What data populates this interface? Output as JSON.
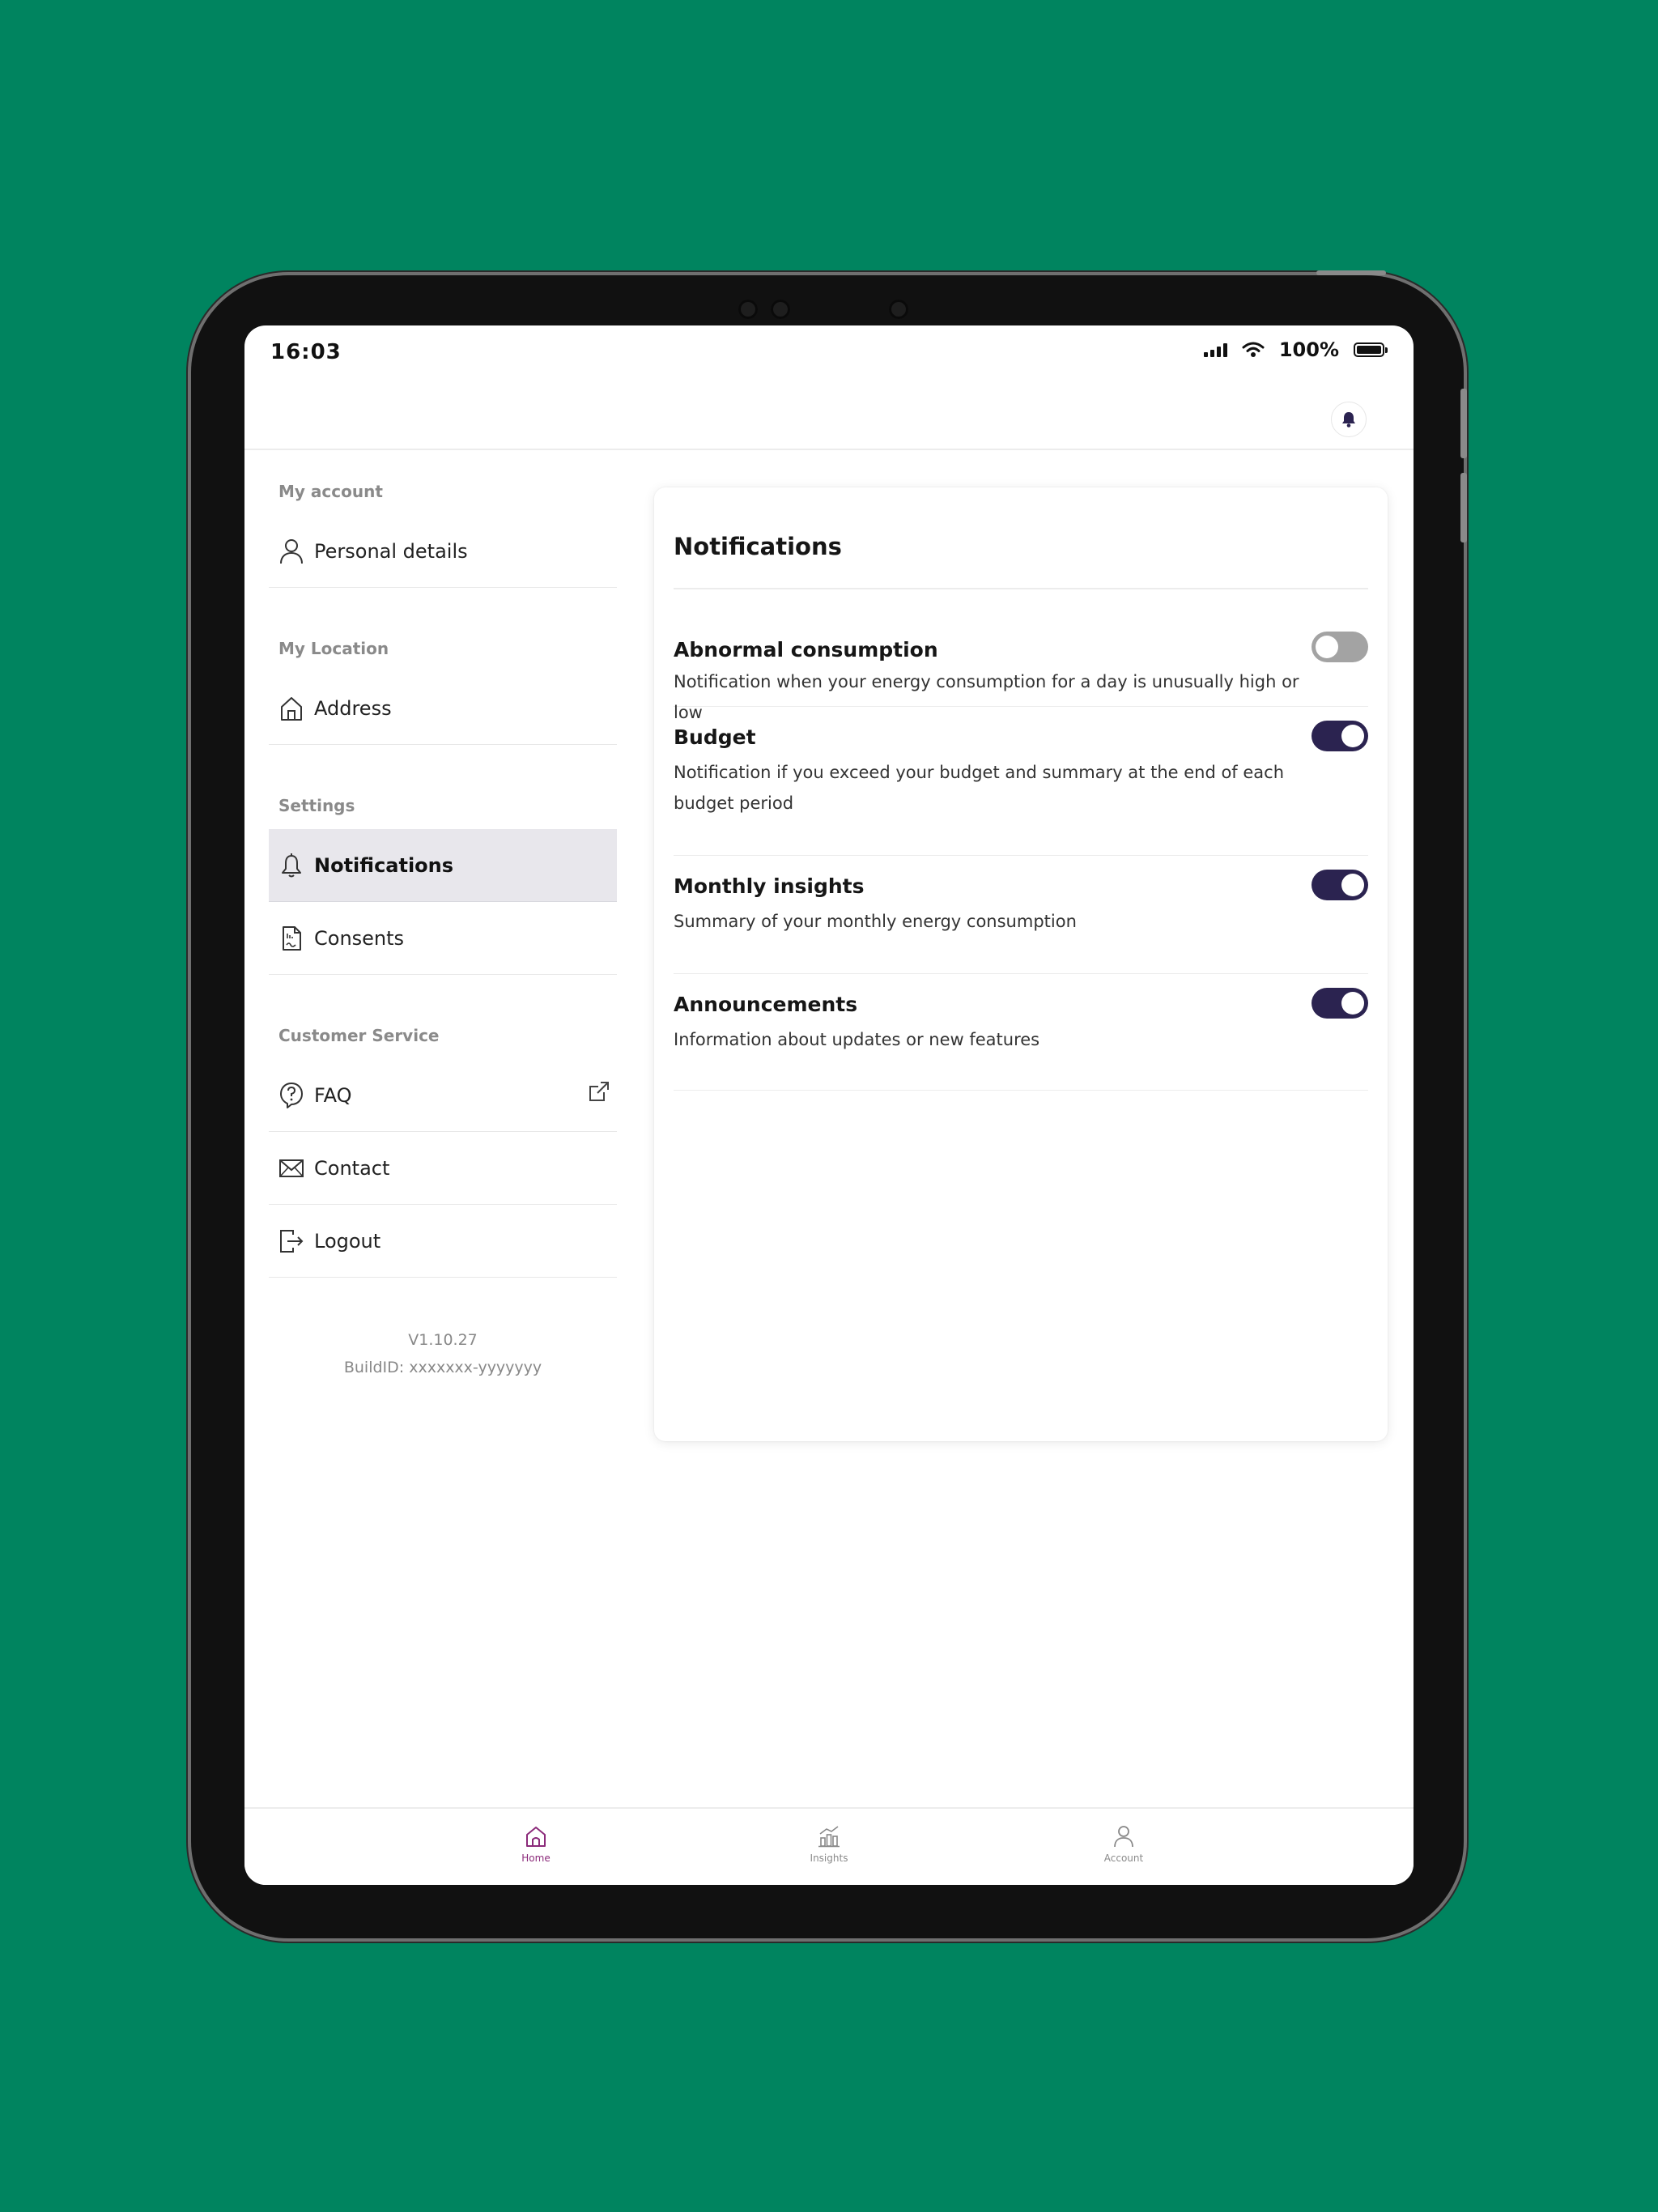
{
  "status_bar": {
    "time": "16:03",
    "battery": "100%"
  },
  "sidebar": {
    "sections": [
      {
        "label": "My account",
        "items": [
          {
            "label": "Personal details"
          }
        ]
      },
      {
        "label": "My Location",
        "items": [
          {
            "label": "Address"
          }
        ]
      },
      {
        "label": "Settings",
        "items": [
          {
            "label": "Notifications"
          },
          {
            "label": "Consents"
          }
        ]
      },
      {
        "label": "Customer Service",
        "items": [
          {
            "label": "FAQ"
          },
          {
            "label": "Contact"
          },
          {
            "label": "Logout"
          }
        ]
      }
    ],
    "version": "V1.10.27",
    "build_id": "BuildID: xxxxxxx-yyyyyyy"
  },
  "notifications": {
    "title": "Notifications",
    "items": [
      {
        "title": "Abnormal consumption",
        "description": "Notification when your energy consumption for a day is unusually high or low",
        "enabled": false
      },
      {
        "title": "Budget",
        "description": "Notification if you exceed your budget and summary at the end of each budget period",
        "enabled": true
      },
      {
        "title": "Monthly insights",
        "description": "Summary of your monthly energy consumption",
        "enabled": true
      },
      {
        "title": "Announcements",
        "description": "Information about updates or new features",
        "enabled": true
      }
    ]
  },
  "bottom_nav": {
    "items": [
      {
        "label": "Home",
        "active": true
      },
      {
        "label": "Insights",
        "active": false
      },
      {
        "label": "Account",
        "active": false
      }
    ]
  },
  "colors": {
    "background": "#00845f",
    "toggle_on": "#2b2350",
    "toggle_off": "#a3a3a3",
    "nav_active": "#8b2a7a"
  }
}
